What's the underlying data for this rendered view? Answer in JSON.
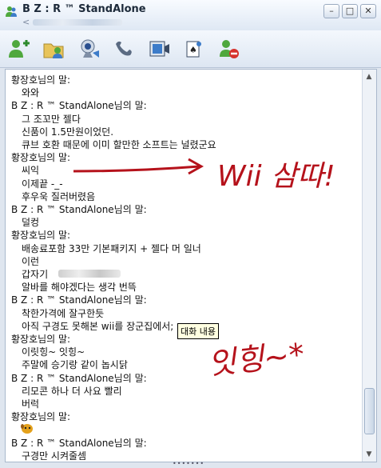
{
  "window": {
    "title": "B Z : R ™ StandAlone",
    "subtitle": "<",
    "buttons": {
      "minimize": "–",
      "maximize": "□",
      "close": "✕"
    }
  },
  "toolbar": {
    "icons": [
      "invite-contact-icon",
      "send-file-icon",
      "webcam-icon",
      "voice-call-icon",
      "video-icon",
      "games-icon",
      "block-contact-icon"
    ]
  },
  "chat": {
    "lines": [
      {
        "type": "sender",
        "text": "황장호님의 말:"
      },
      {
        "type": "msg",
        "text": "와와"
      },
      {
        "type": "sender",
        "text": "B Z : R ™ StandAlone님의 말:"
      },
      {
        "type": "msg",
        "text": "그 조꼬만 젤다"
      },
      {
        "type": "msg",
        "text": "신품이 1.5만원이었던."
      },
      {
        "type": "msg",
        "text": "큐브 호환 때문에 이미 할만한 소프트는 널렸군요"
      },
      {
        "type": "sender",
        "text": "황장호님의 말:"
      },
      {
        "type": "msg",
        "text": "씨익"
      },
      {
        "type": "msg",
        "text": "이제끝 -_-"
      },
      {
        "type": "msg",
        "text": "후우욱 질러버렸음"
      },
      {
        "type": "sender",
        "text": "B Z : R ™ StandAlone님의 말:"
      },
      {
        "type": "msg",
        "text": "덜컹"
      },
      {
        "type": "sender",
        "text": "황장호님의 말:"
      },
      {
        "type": "msg",
        "text": "배송료포함 33만 기본패키지 + 젤다 머 일너"
      },
      {
        "type": "msg",
        "text": "이런"
      },
      {
        "type": "msg",
        "text": "갑자기"
      },
      {
        "type": "msg",
        "text": "알바를 해야겠다는 생각 번뜩"
      },
      {
        "type": "sender",
        "text": "B Z : R ™ StandAlone님의 말:"
      },
      {
        "type": "msg",
        "text": "착한가격에 잘구한듯"
      },
      {
        "type": "msg",
        "text": "아직 구경도 못해본 wii를 장군집에서;"
      },
      {
        "type": "sender",
        "text": "황장호님의 말:"
      },
      {
        "type": "msg",
        "text": "이릿힝~ 잇힝~"
      },
      {
        "type": "msg",
        "text": "주말에 승기랑 같이 놉시닭"
      },
      {
        "type": "sender",
        "text": "B Z : R ™ StandAlone님의 말:"
      },
      {
        "type": "msg",
        "text": "리모콘 하나 더 사요 빨리"
      },
      {
        "type": "msg",
        "text": "버럭"
      },
      {
        "type": "sender",
        "text": "황장호님의 말:"
      },
      {
        "type": "msg",
        "text": ""
      },
      {
        "type": "sender",
        "text": "B Z : R ™ StandAlone님의 말:"
      },
      {
        "type": "msg",
        "text": "구경만 시켜줄셈"
      }
    ],
    "tooltip": "대화 내용",
    "emoticon": "dog-emoticon-icon"
  },
  "annotations": {
    "text1": "Wii 삼따!",
    "text2": "잇힝~*",
    "color": "#b5121b"
  }
}
